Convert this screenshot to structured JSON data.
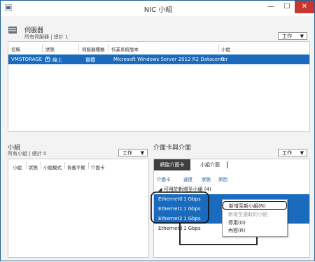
{
  "window": {
    "title": "NIC 小組",
    "min": "—",
    "max": "☐",
    "close": "✕"
  },
  "servers": {
    "heading": "伺服器",
    "subheading": "所有伺服器 | 總計 1",
    "tasks": "工作",
    "columns": [
      "名稱",
      "狀態",
      "伺服器種類",
      "作業系統版本",
      "小組"
    ],
    "row": {
      "name": "VMSTORAGE",
      "status": "線上",
      "type": "實體",
      "os": "Microsoft Windows Server 2012 R2 Datacenter",
      "teams": "0"
    }
  },
  "teams": {
    "heading": "小組",
    "subheading": "所有小組 | 總計 0",
    "tasks": "工作",
    "columns": [
      "小組",
      "狀態",
      "小組模式",
      "負載平衡",
      "介面卡"
    ]
  },
  "adapters": {
    "heading": "介面卡與介面",
    "tasks": "工作",
    "tabs": [
      "網路介面卡",
      "小組介面"
    ],
    "columns": [
      "介面卡",
      "速度",
      "狀態",
      "原因"
    ],
    "group": "可用於新增至小組 (4)",
    "rows": [
      {
        "name": "Ethernet0",
        "speed": "1 Gbps"
      },
      {
        "name": "Ethernet1",
        "speed": "1 Gbps"
      },
      {
        "name": "Ethernet2",
        "speed": "1 Gbps"
      },
      {
        "name": "Ethernet3",
        "speed": "1 Gbps"
      }
    ],
    "menu": [
      "新增至新小組(N)",
      "新增至選取的小組",
      "停用(D)",
      "內容(R)"
    ]
  },
  "colors": {
    "selection": "#1a6bbd",
    "tab_active": "#3f3f3f",
    "close": "#c7372f"
  }
}
